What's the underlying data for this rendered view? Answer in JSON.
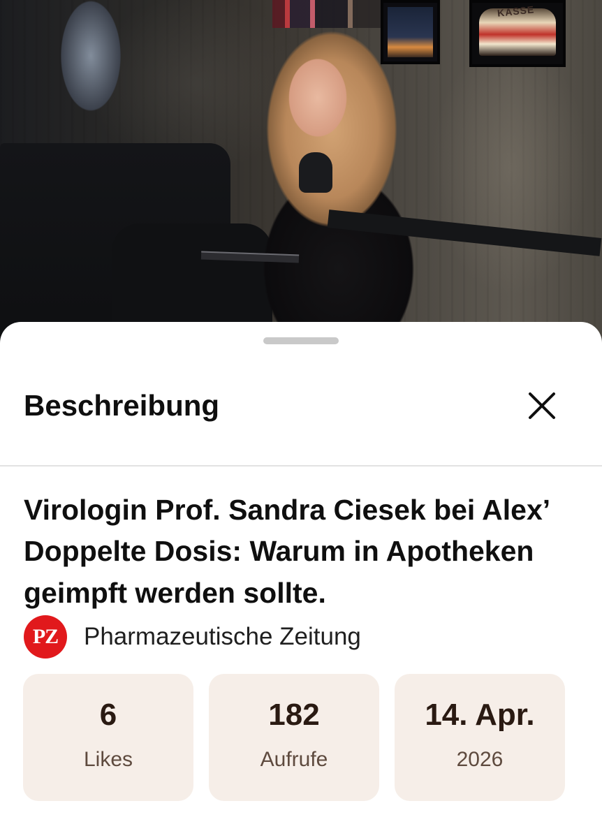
{
  "video_backdrop": {
    "frame_sign_text": "KASSE"
  },
  "sheet": {
    "title": "Beschreibung",
    "close_icon": "close-icon",
    "video_title": "Virologin Prof. Sandra Ciesek bei Alex’ Doppelte Dosis: Warum in Apotheken geimpft werden sollte.",
    "channel": {
      "logo_text": "PZ",
      "logo_color": "#e1191c",
      "name": "Pharmazeutische Zeitung"
    },
    "stats": [
      {
        "value": "6",
        "label": "Likes"
      },
      {
        "value": "182",
        "label": "Aufrufe"
      },
      {
        "value": "14. Apr.",
        "label": "2026"
      }
    ],
    "card_color": "#f6eee8"
  }
}
